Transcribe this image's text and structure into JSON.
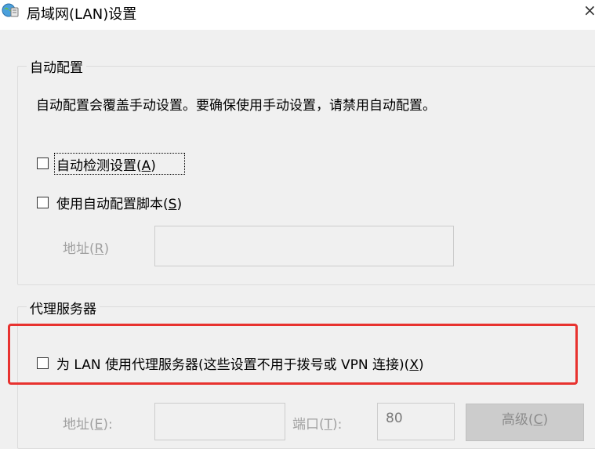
{
  "window": {
    "title": "局域网(LAN)设置",
    "close_glyph": "×"
  },
  "auto_config": {
    "legend": "自动配置",
    "description": "自动配置会覆盖手动设置。要确保使用手动设置，请禁用自动配置。",
    "detect": {
      "label": "自动检测设置(",
      "mnemonic": "A",
      "suffix": ")",
      "checked": false
    },
    "script": {
      "label": "使用自动配置脚本(",
      "mnemonic": "S",
      "suffix": ")",
      "checked": false
    },
    "address": {
      "label": "地址(",
      "mnemonic": "R",
      "suffix": ")",
      "value": ""
    }
  },
  "proxy": {
    "legend": "代理服务器",
    "use_proxy": {
      "label": "为 LAN 使用代理服务器(这些设置不用于拨号或 VPN 连接)(",
      "mnemonic": "X",
      "suffix": ")",
      "checked": false
    },
    "address": {
      "label": "地址(",
      "mnemonic": "E",
      "suffix": "):",
      "value": ""
    },
    "port": {
      "label": "端口(",
      "mnemonic": "T",
      "suffix": "):",
      "value": "80"
    },
    "advanced": {
      "label": "高级(",
      "mnemonic": "C",
      "suffix": ")"
    }
  },
  "colors": {
    "highlight": "#e8322f",
    "background": "#f0f0f0"
  },
  "icons": {
    "title": "network-globe-icon",
    "close": "close-icon"
  }
}
